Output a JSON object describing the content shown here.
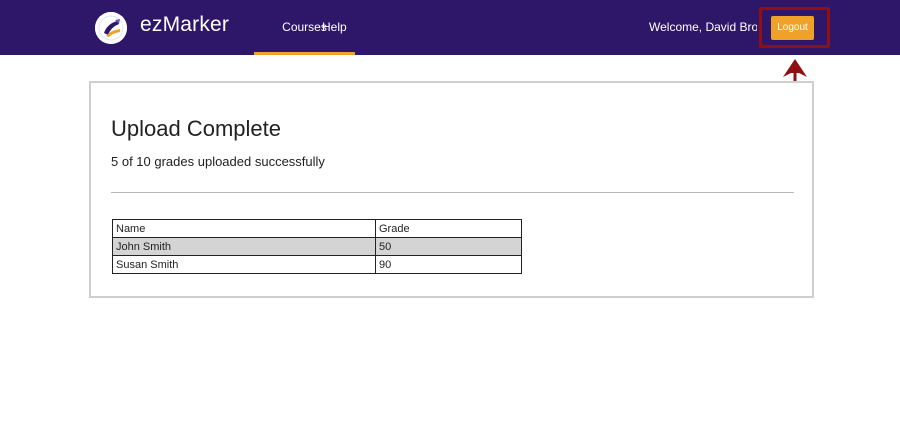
{
  "header": {
    "brand": "ezMarker",
    "logo_icon": "ezmarker-logo-icon",
    "nav": [
      {
        "label": "Courses",
        "active": true
      },
      {
        "label": "Help",
        "active": false
      }
    ],
    "welcome": "Welcome, David Brown",
    "logout_label": "Logout"
  },
  "annotation": {
    "highlight_color": "#8f0f12",
    "arrow_icon": "arrow-up-icon"
  },
  "main": {
    "title": "Upload Complete",
    "status": "5 of 10 grades uploaded successfully",
    "table": {
      "headers": [
        "Name",
        "Grade"
      ],
      "rows": [
        [
          "John Smith",
          "50"
        ],
        [
          "Susan Smith",
          "90"
        ]
      ]
    }
  },
  "colors": {
    "navbar": "#2e1769",
    "accent": "#f0a12a"
  }
}
